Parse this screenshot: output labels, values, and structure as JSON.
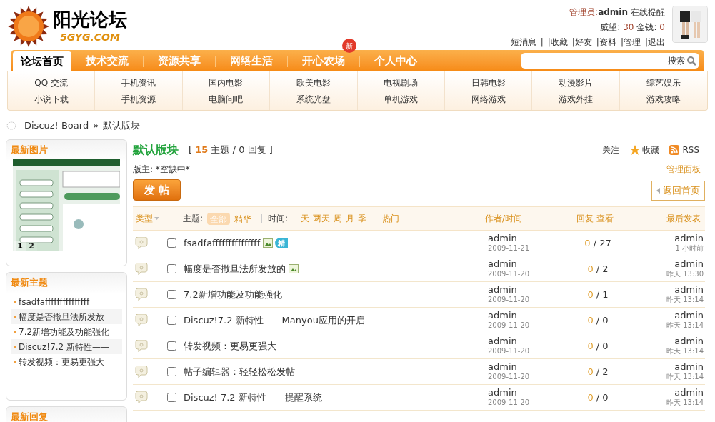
{
  "logo": {
    "title": "阳光论坛",
    "domain": "5GYG.COM"
  },
  "user": {
    "role": "管理员:",
    "name": "admin",
    "notice": "在线提醒",
    "rep_label": "威望:",
    "rep": "30",
    "money_label": "金钱:",
    "money": "0",
    "links": [
      "短消息",
      "|",
      "|收藏",
      "|好友",
      "|资料",
      "|管理",
      "|退出"
    ]
  },
  "nav": [
    {
      "label": "论坛首页",
      "selected": true
    },
    {
      "label": "技术交流",
      "selected": false
    },
    {
      "label": "资源共享",
      "selected": false
    },
    {
      "label": "网络生活",
      "selected": false
    },
    {
      "label": "开心农场",
      "selected": false,
      "badge": "新"
    },
    {
      "label": "个人中心",
      "selected": false
    }
  ],
  "search": {
    "button": "搜索"
  },
  "subnav": [
    [
      "QQ 交流",
      "小说下载"
    ],
    [
      "手机资讯",
      "手机资源"
    ],
    [
      "国内电影",
      "电脑问吧"
    ],
    [
      "欧美电影",
      "系统光盘"
    ],
    [
      "电视剧场",
      "单机游戏"
    ],
    [
      "日韩电影",
      "网络游戏"
    ],
    [
      "动漫影片",
      "游戏外挂"
    ],
    [
      "综艺娱乐",
      "游戏攻略"
    ]
  ],
  "breadcrumb": [
    "Discuz! Board",
    "»",
    "默认版块"
  ],
  "sidebar": {
    "pictures": {
      "title": "最新图片",
      "pages": [
        {
          "label": "1",
          "selected": true
        },
        {
          "label": "2",
          "selected": false
        }
      ]
    },
    "topics": {
      "title": "最新主题",
      "items": [
        "fsadfafffffffffffffff",
        "幅度是否撒旦法所发放",
        "7.2新增功能及功能强化",
        "Discuz!7.2 新特性——",
        "转发视频：更易更强大"
      ]
    },
    "replies": {
      "title": "最新回复"
    }
  },
  "forum": {
    "title": "默认版块",
    "open": "[",
    "topics": "15",
    "topics_label": "主题",
    "sep": "/",
    "replies": "0",
    "replies_label": "回复",
    "close": "]",
    "actions": [
      "关注",
      "收藏",
      "RSS"
    ],
    "moderator": "版主: *空缺中*",
    "panel": "管理面板",
    "post_button": "发 帖",
    "back": "返回首页"
  },
  "filters": {
    "type": "类型",
    "topic_label": "主题:",
    "topic": [
      {
        "label": "全部",
        "selected": true
      },
      {
        "label": "精华",
        "selected": false
      }
    ],
    "time_label": "时间:",
    "time": [
      "一天",
      "两天",
      "周",
      "月",
      "季"
    ],
    "hot": "热门",
    "col_author": "作者/时间",
    "col_stats": "回复 查看",
    "col_last": "最后发表"
  },
  "threads": [
    {
      "title": "fsadfafffffffffffffff",
      "attachment": true,
      "digest": "精",
      "checked": false,
      "author": "admin",
      "date": "2009-11-21",
      "replies": "0",
      "sep": "/",
      "views": "27",
      "last_author": "admin",
      "last_time": "1 小时前"
    },
    {
      "title": "幅度是否撒旦法所发放的",
      "attachment": true,
      "checked": false,
      "author": "admin",
      "date": "2009-11-20",
      "replies": "0",
      "sep": "/",
      "views": "2",
      "last_author": "admin",
      "last_time": "昨天 13:30"
    },
    {
      "title": "7.2新增功能及功能强化",
      "attachment": false,
      "checked": false,
      "author": "admin",
      "date": "2009-11-20",
      "replies": "0",
      "sep": "/",
      "views": "1",
      "last_author": "admin",
      "last_time": "昨天 13:14"
    },
    {
      "title": "Discuz!7.2 新特性——Manyou应用的开启",
      "attachment": false,
      "checked": false,
      "author": "admin",
      "date": "2009-11-20",
      "replies": "0",
      "sep": "/",
      "views": "0",
      "last_author": "admin",
      "last_time": "昨天 13:14"
    },
    {
      "title": "转发视频：更易更强大",
      "attachment": false,
      "checked": false,
      "author": "admin",
      "date": "2009-11-20",
      "replies": "0",
      "sep": "/",
      "views": "0",
      "last_author": "admin",
      "last_time": "昨天 13:14"
    },
    {
      "title": "帖子编辑器：轻轻松松发帖",
      "attachment": false,
      "checked": false,
      "author": "admin",
      "date": "2009-11-20",
      "replies": "0",
      "sep": "/",
      "views": "2",
      "last_author": "admin",
      "last_time": "昨天 13:14"
    },
    {
      "title": "Discuz! 7.2 新特性——提醒系统",
      "attachment": false,
      "checked": false,
      "author": "admin",
      "date": "2009-11-20",
      "replies": "0",
      "sep": "/",
      "views": "0",
      "last_author": "admin",
      "last_time": "昨天 13:14"
    }
  ]
}
